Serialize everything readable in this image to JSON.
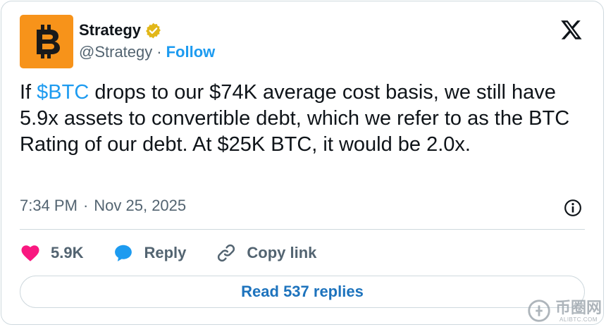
{
  "author": {
    "name": "Strategy",
    "handle": "@Strategy",
    "separator": "·",
    "follow_label": "Follow",
    "avatar_icon": "bitcoin-b-icon",
    "avatar_color": "#f7931a",
    "verified_color": "#e2b719"
  },
  "tweet": {
    "text_before": "If ",
    "cashtag": "$BTC",
    "text_after": " drops to our $74K average cost basis, we still have 5.9x assets to convertible debt, which we refer to as the BTC Rating of our debt. At $25K BTC, it would be 2.0x.",
    "time": "7:34 PM",
    "separator": "·",
    "date": "Nov 25, 2025"
  },
  "actions": {
    "likes": "5.9K",
    "reply_label": "Reply",
    "copy_link_label": "Copy link"
  },
  "read_replies_label": "Read 537 replies",
  "watermark": {
    "cn": "币圈网",
    "url": "ALIBTC.COM"
  },
  "colors": {
    "accent": "#1d9bf0",
    "like": "#f91880",
    "muted": "#536471"
  }
}
